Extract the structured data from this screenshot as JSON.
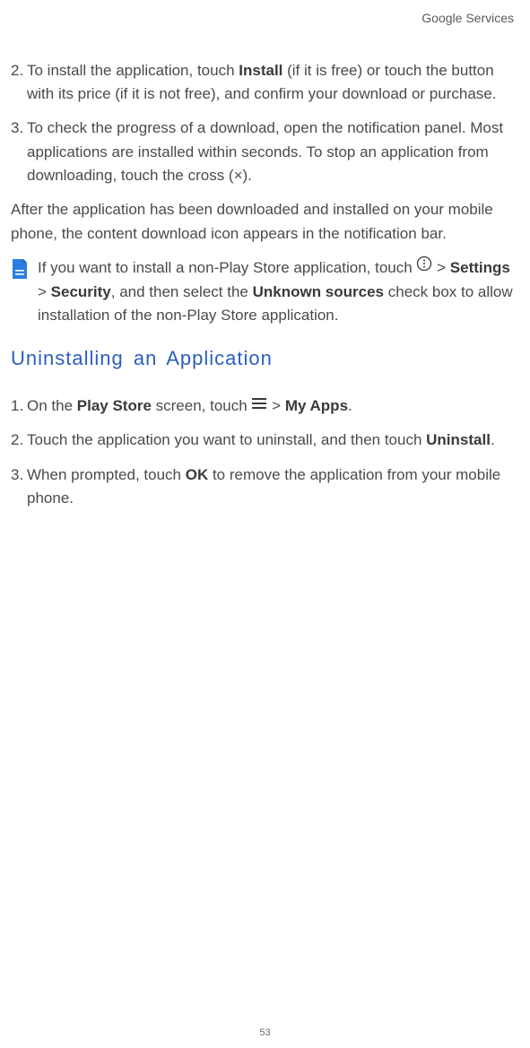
{
  "header": {
    "section": "Google Services"
  },
  "install": {
    "step2_num": "2. ",
    "step2_a": "To install the application, touch ",
    "step2_b": "Install",
    "step2_c": " (if it is free) or touch the button with its price (if it is not free), and confirm your download or purchase.",
    "step3_num": "3. ",
    "step3_a": "To check the progress of a download, open the notification panel. Most applications are installed within seconds. To stop an application from downloading, touch the cross (×).",
    "after_para": "After the application has been downloaded and installed on your mobile phone, the content download icon appears in the notification bar."
  },
  "note": {
    "a": "If you want to install a non-Play Store application, touch ",
    "b": " > ",
    "c": "Settings",
    "d": " > ",
    "e": "Security",
    "f": ", and then select the ",
    "g": "Unknown sources",
    "h": " check box to allow installation of the non-Play Store application."
  },
  "uninstall": {
    "heading": "Uninstalling an Application",
    "step1_num": "1. ",
    "step1_a": "On the ",
    "step1_b": "Play Store",
    "step1_c": " screen, touch ",
    "step1_d": " > ",
    "step1_e": "My Apps",
    "step1_f": ".",
    "step2_num": "2. ",
    "step2_a": "Touch the application you want to uninstall, and then touch ",
    "step2_b": "Uninstall",
    "step2_c": ".",
    "step3_num": "3. ",
    "step3_a": "When prompted, touch ",
    "step3_b": "OK",
    "step3_c": " to remove the application from your mobile phone."
  },
  "page_number": "53"
}
